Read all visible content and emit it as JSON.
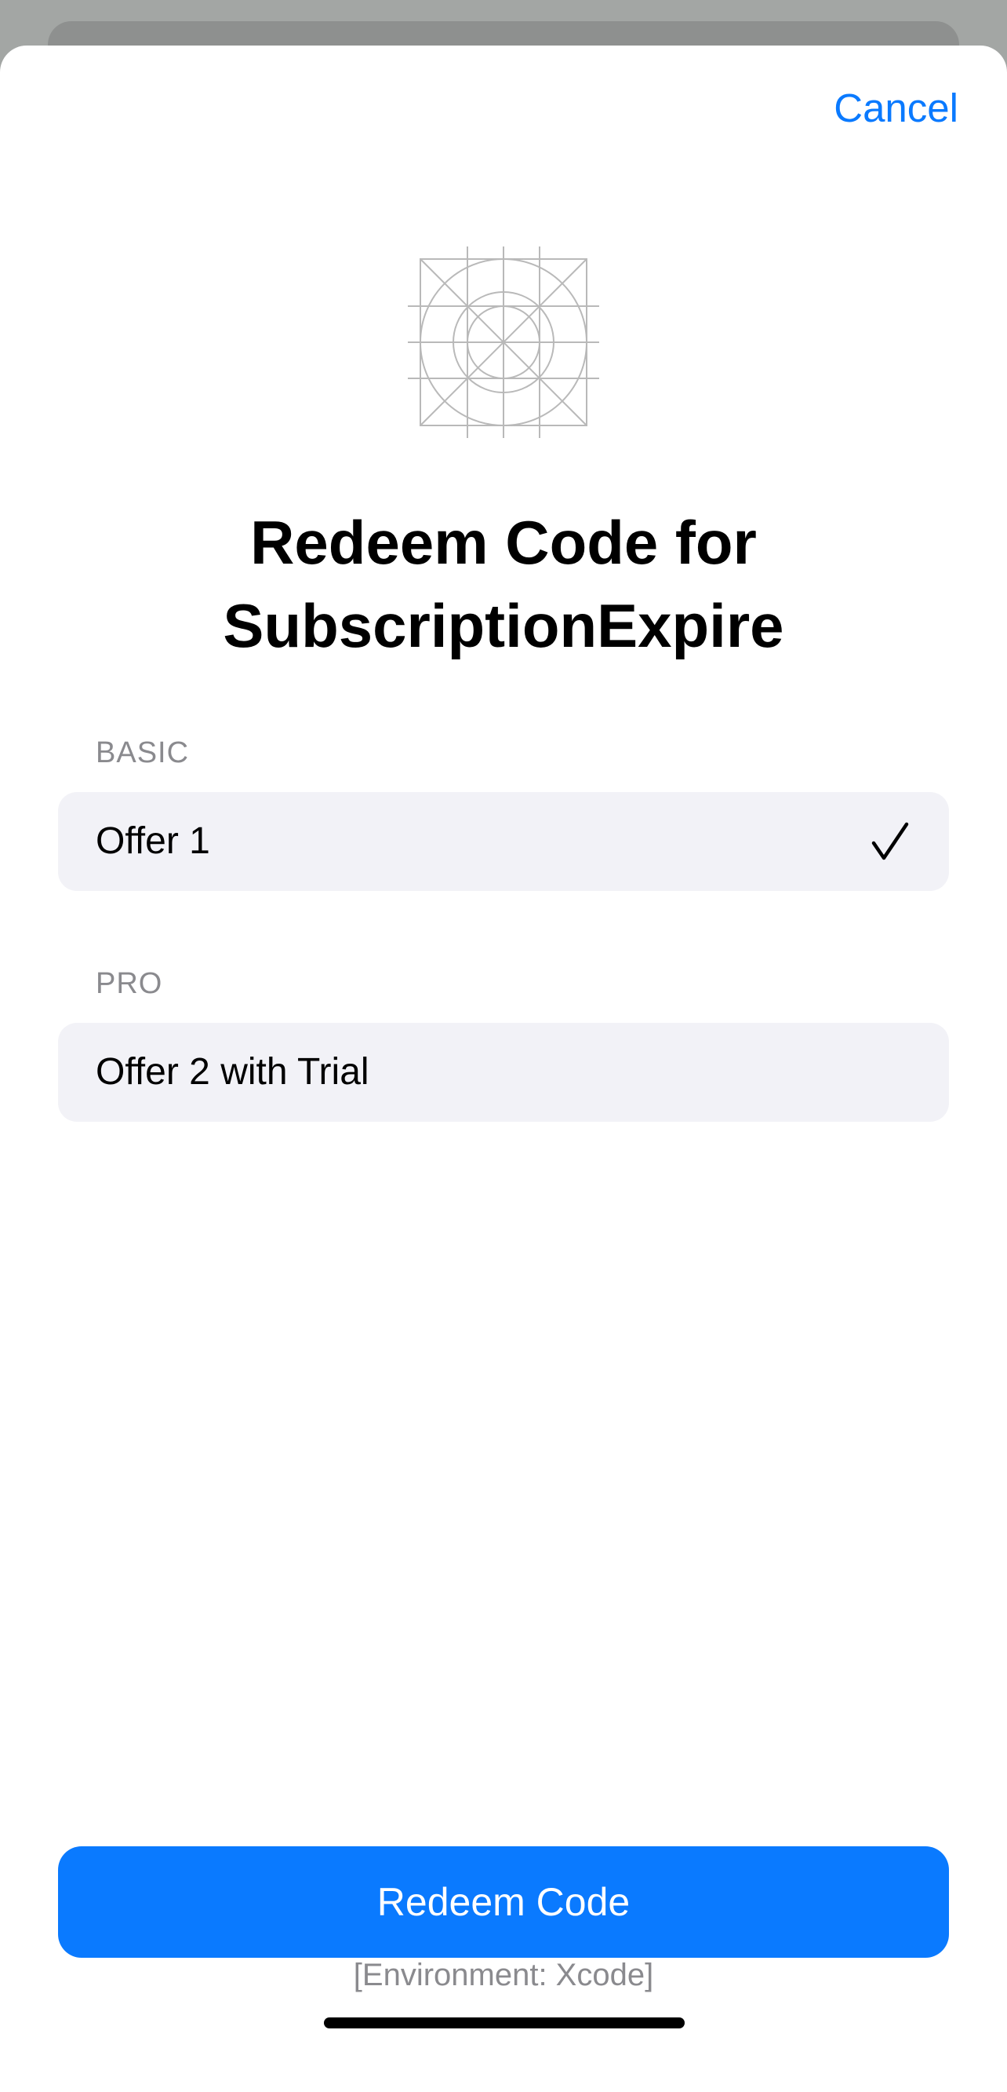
{
  "header": {
    "cancel_label": "Cancel"
  },
  "app_icon": {
    "icon": "app-icon-placeholder-grid"
  },
  "title": {
    "line1": "Redeem Code for",
    "line2": "SubscriptionExpire"
  },
  "sections": [
    {
      "header": "BASIC",
      "offers": [
        {
          "label": "Offer 1",
          "selected": true
        }
      ]
    },
    {
      "header": "PRO",
      "offers": [
        {
          "label": "Offer 2 with Trial",
          "selected": false
        }
      ]
    }
  ],
  "redeem_button_label": "Redeem Code",
  "environment_text": "[Environment: Xcode]",
  "colors": {
    "accent": "#0a7aff",
    "row_background": "#f2f2f7",
    "secondary_text": "#8a8a8e",
    "backdrop": "#a3a6a4"
  }
}
